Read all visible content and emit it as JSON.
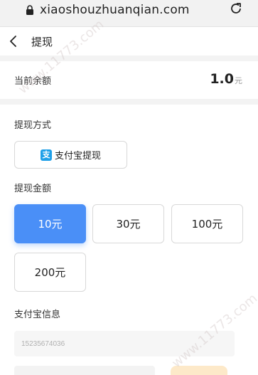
{
  "browser": {
    "url": "xiaoshouzhuanqian.com",
    "lock_icon": "lock-icon",
    "reload_icon": "reload-icon"
  },
  "nav": {
    "back_icon": "chevron-left-icon",
    "title": "提现"
  },
  "balance": {
    "label": "当前余额",
    "value": "1.0",
    "unit": "元"
  },
  "method": {
    "label": "提现方式",
    "option_icon": "alipay-icon",
    "option_icon_glyph": "支",
    "option_label": "支付宝提现"
  },
  "amount": {
    "label": "提现金额",
    "options": [
      "10元",
      "30元",
      "100元",
      "200元"
    ],
    "selected": "10元"
  },
  "alipay_info": {
    "label": "支付宝信息",
    "account_placeholder": "15235674036"
  },
  "watermark": {
    "text": "www.11773.com"
  },
  "colors": {
    "accent": "#4a8ff7",
    "alipay": "#1fa0e8",
    "divider": "#f3f3f3"
  }
}
